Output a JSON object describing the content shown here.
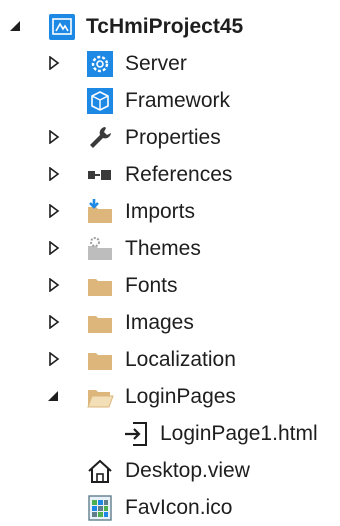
{
  "tree": {
    "root": {
      "label": "TcHmiProject45",
      "icon": "hmi-project-icon",
      "expanded": true
    },
    "items": [
      {
        "label": "Server",
        "icon": "server-gear-icon",
        "expander": "collapsed"
      },
      {
        "label": "Framework",
        "icon": "framework-cube-icon",
        "expander": "none"
      },
      {
        "label": "Properties",
        "icon": "wrench-icon",
        "expander": "collapsed"
      },
      {
        "label": "References",
        "icon": "references-icon",
        "expander": "collapsed"
      },
      {
        "label": "Imports",
        "icon": "imports-folder-icon",
        "expander": "collapsed"
      },
      {
        "label": "Themes",
        "icon": "themes-folder-icon",
        "expander": "collapsed"
      },
      {
        "label": "Fonts",
        "icon": "folder-icon",
        "expander": "collapsed"
      },
      {
        "label": "Images",
        "icon": "folder-icon",
        "expander": "collapsed"
      },
      {
        "label": "Localization",
        "icon": "folder-icon",
        "expander": "collapsed"
      },
      {
        "label": "LoginPages",
        "icon": "open-folder-icon",
        "expander": "expanded"
      },
      {
        "label": "LoginPage1.html",
        "icon": "login-page-icon",
        "expander": "none"
      },
      {
        "label": "Desktop.view",
        "icon": "home-icon",
        "expander": "none"
      },
      {
        "label": "FavIcon.ico",
        "icon": "ico-file-icon",
        "expander": "none"
      }
    ]
  },
  "colors": {
    "text": "#1e1e1e",
    "accent_blue": "#1e88e5",
    "folder": "#dcb67a",
    "expander": "#1e1e1e"
  }
}
